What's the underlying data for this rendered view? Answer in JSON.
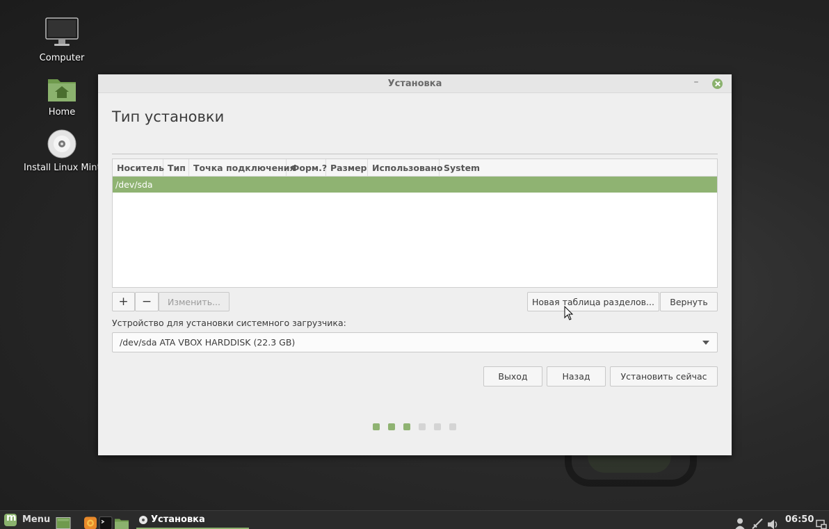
{
  "desktop": {
    "icons": [
      {
        "label": "Computer"
      },
      {
        "label": "Home"
      },
      {
        "label": "Install Linux Mint"
      }
    ]
  },
  "window": {
    "title": "Установка",
    "heading": "Тип установки",
    "table": {
      "columns": [
        "Носитель",
        "Тип",
        "Точка подключения",
        "Форм.?",
        "Размер",
        "Использовано",
        "System"
      ],
      "rows": [
        {
          "device": "/dev/sda",
          "selected": true
        }
      ]
    },
    "buttons": {
      "add": "+",
      "remove": "−",
      "change": "Изменить...",
      "new_table": "Новая таблица разделов...",
      "revert": "Вернуть",
      "quit": "Выход",
      "back": "Назад",
      "install_now": "Установить сейчас"
    },
    "bootloader_label": "Устройство для установки системного загрузчика:",
    "bootloader_device": "/dev/sda ATA VBOX HARDDISK (22.3 GB)",
    "progress": {
      "current_step": 3,
      "total_steps": 6
    }
  },
  "taskbar": {
    "menu_label": "Menu",
    "active_task": "Установка",
    "clock": "06:50"
  },
  "colors": {
    "accent": "#8fb372",
    "window_bg": "#efefef"
  }
}
